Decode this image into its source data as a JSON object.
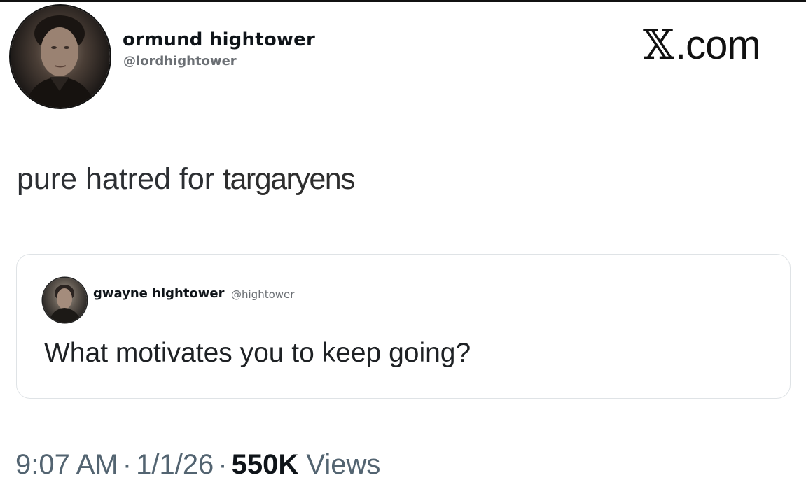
{
  "author": {
    "name": "ormund hightower",
    "handle": "@lordhightower"
  },
  "brand": {
    "glyph": "𝕏",
    "text": ".com"
  },
  "tweet": {
    "text_part1": "pure hatred for ",
    "text_part2": "targaryens"
  },
  "quoted_tweet": {
    "name": "gwayne hightower",
    "handle": "@hightower",
    "text": "What motivates you to keep going?"
  },
  "meta": {
    "time": "9:07 AM",
    "separator": "·",
    "date": "1/1/26",
    "views_count": "550K",
    "views_label": "Views"
  },
  "colors": {
    "text_primary": "#0f1419",
    "text_secondary": "#536471",
    "card_border": "#dfe3e6",
    "background": "#ffffff"
  }
}
